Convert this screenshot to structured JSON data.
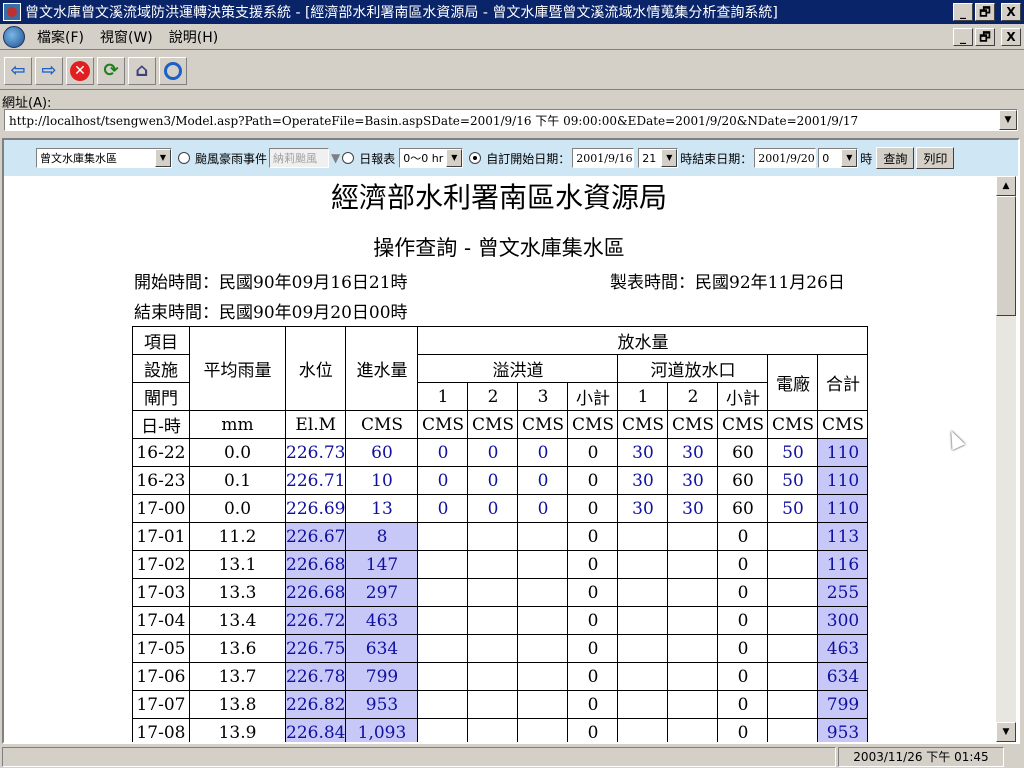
{
  "window": {
    "title": "曾文水庫曾文溪流域防洪運轉決策支援系統 - [經濟部水利署南區水資源局 - 曾文水庫暨曾文溪流域水情蒐集分析查詢系統]",
    "caption_buttons": [
      "_",
      "🗗",
      "X"
    ]
  },
  "menu": {
    "items": [
      "檔案(F)",
      "視窗(W)",
      "說明(H)"
    ]
  },
  "toolbar": {
    "buttons": [
      "back",
      "forward",
      "stop",
      "refresh",
      "home",
      "search"
    ]
  },
  "address": {
    "label": "網址(A):",
    "url": "http://localhost/tsengwen3/Model.asp?Path=OperateFile=Basin.aspSDate=2001/9/16 下午 09:00:00&EDate=2001/9/20&NDate=2001/9/17"
  },
  "query": {
    "area_select": "曾文水庫集水區",
    "typhoon_label": "颱風豪雨事件",
    "typhoon_value": "納莉颱風",
    "daily_label": "日報表",
    "hour_range": "0～0 hr",
    "custom_start_label": "自訂開始日期：",
    "start_date": "2001/9/16",
    "start_hour": "21",
    "end_label": "時結束日期：",
    "end_date": "2001/9/20",
    "end_hour": "0",
    "hour_suffix": "時",
    "query_button": "查詢",
    "print_button": "列印"
  },
  "report": {
    "agency": "經濟部水利署南區水資源局",
    "title": "操作查詢 - 曾文水庫集水區",
    "start_time": "開始時間：民國90年09月16日21時",
    "made_time": "製表時間：民國92年11月26日",
    "end_time": "結束時間：民國90年09月20日00時",
    "headers": {
      "item": "項目",
      "facility": "設施",
      "gate": "閘門",
      "datetime": "日-時",
      "rain": "平均雨量",
      "level": "水位",
      "inflow": "進水量",
      "release": "放水量",
      "spillway": "溢洪道",
      "river_outlet": "河道放水口",
      "power": "電廠",
      "total": "合計",
      "g1": "1",
      "g2": "2",
      "g3": "3",
      "subtotal": "小計",
      "r1": "1",
      "r2": "2",
      "rsub": "小計",
      "unit_mm": "mm",
      "unit_elm": "El.M",
      "unit_cms": "CMS"
    },
    "rows": [
      {
        "t": "16-22",
        "rain": "0.0",
        "lvl": "226.73",
        "in": "60",
        "s1": "0",
        "s2": "0",
        "s3": "0",
        "ssub": "0",
        "r1": "30",
        "r2": "30",
        "rsub": "60",
        "pw": "50",
        "tot": "110"
      },
      {
        "t": "16-23",
        "rain": "0.1",
        "lvl": "226.71",
        "in": "10",
        "s1": "0",
        "s2": "0",
        "s3": "0",
        "ssub": "0",
        "r1": "30",
        "r2": "30",
        "rsub": "60",
        "pw": "50",
        "tot": "110"
      },
      {
        "t": "17-00",
        "rain": "0.0",
        "lvl": "226.69",
        "in": "13",
        "s1": "0",
        "s2": "0",
        "s3": "0",
        "ssub": "0",
        "r1": "30",
        "r2": "30",
        "rsub": "60",
        "pw": "50",
        "tot": "110"
      },
      {
        "t": "17-01",
        "rain": "11.2",
        "lvl": "226.67",
        "in": "8",
        "s1": "",
        "s2": "",
        "s3": "",
        "ssub": "0",
        "r1": "",
        "r2": "",
        "rsub": "0",
        "pw": "",
        "tot": "113"
      },
      {
        "t": "17-02",
        "rain": "13.1",
        "lvl": "226.68",
        "in": "147",
        "s1": "",
        "s2": "",
        "s3": "",
        "ssub": "0",
        "r1": "",
        "r2": "",
        "rsub": "0",
        "pw": "",
        "tot": "116"
      },
      {
        "t": "17-03",
        "rain": "13.3",
        "lvl": "226.68",
        "in": "297",
        "s1": "",
        "s2": "",
        "s3": "",
        "ssub": "0",
        "r1": "",
        "r2": "",
        "rsub": "0",
        "pw": "",
        "tot": "255"
      },
      {
        "t": "17-04",
        "rain": "13.4",
        "lvl": "226.72",
        "in": "463",
        "s1": "",
        "s2": "",
        "s3": "",
        "ssub": "0",
        "r1": "",
        "r2": "",
        "rsub": "0",
        "pw": "",
        "tot": "300"
      },
      {
        "t": "17-05",
        "rain": "13.6",
        "lvl": "226.75",
        "in": "634",
        "s1": "",
        "s2": "",
        "s3": "",
        "ssub": "0",
        "r1": "",
        "r2": "",
        "rsub": "0",
        "pw": "",
        "tot": "463"
      },
      {
        "t": "17-06",
        "rain": "13.7",
        "lvl": "226.78",
        "in": "799",
        "s1": "",
        "s2": "",
        "s3": "",
        "ssub": "0",
        "r1": "",
        "r2": "",
        "rsub": "0",
        "pw": "",
        "tot": "634"
      },
      {
        "t": "17-07",
        "rain": "13.8",
        "lvl": "226.82",
        "in": "953",
        "s1": "",
        "s2": "",
        "s3": "",
        "ssub": "0",
        "r1": "",
        "r2": "",
        "rsub": "0",
        "pw": "",
        "tot": "799"
      },
      {
        "t": "17-08",
        "rain": "13.9",
        "lvl": "226.84",
        "in": "1,093",
        "s1": "",
        "s2": "",
        "s3": "",
        "ssub": "0",
        "r1": "",
        "r2": "",
        "rsub": "0",
        "pw": "",
        "tot": "953"
      }
    ]
  },
  "status": {
    "clock": "2003/11/26  下午 01:45"
  },
  "colors": {
    "titlebar": "#0a246a",
    "form_strip": "#cfe6f5",
    "highlight_cell": "#c8c8f8",
    "value_blue": "#1010a0"
  }
}
